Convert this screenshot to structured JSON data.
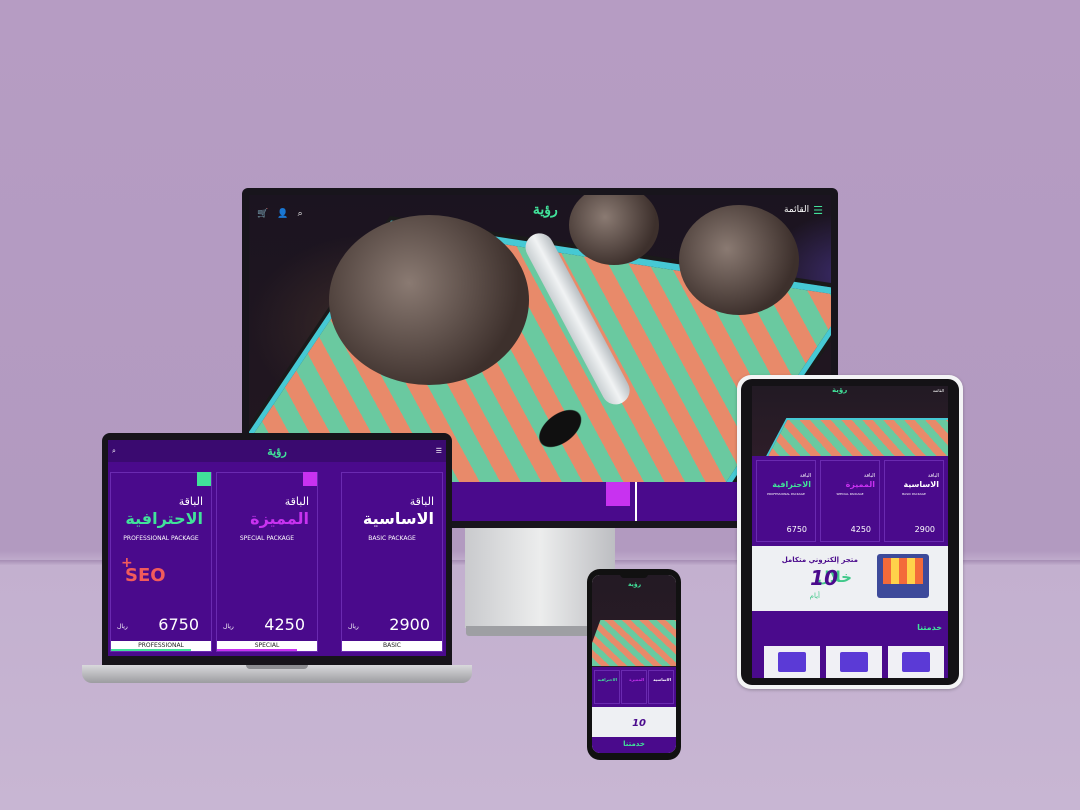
{
  "brand": {
    "logo": "رؤية",
    "accent": "#41e29a",
    "purple": "#4a0a8c",
    "magenta": "#c832f0"
  },
  "nav": {
    "menu_label": "القائمة",
    "icons": [
      "cart-icon",
      "user-icon",
      "search-icon",
      "menu-icon"
    ]
  },
  "packages": [
    {
      "prefix": "الباقة",
      "name": "الاحترافية",
      "name_en": "PROFESSIONAL PACKAGE",
      "price": "6750",
      "currency": "ريال",
      "footer": "PROFESSIONAL",
      "color": "#41e29a",
      "badge": "SEO"
    },
    {
      "prefix": "الباقة",
      "name": "المميزة",
      "name_en": "SPECIAL PACKAGE",
      "price": "4250",
      "currency": "ريال",
      "footer": "SPECIAL",
      "color": "#c832f0"
    },
    {
      "prefix": "الباقة",
      "name": "الاساسية",
      "name_en": "BASIC PACKAGE",
      "price": "2900",
      "currency": "ريال",
      "footer": "BASIC",
      "color": "#ffffff"
    }
  ],
  "promo": {
    "title": "متجر إلكتروني متكامل",
    "number": "10",
    "within": "خلال",
    "days": "أيام"
  },
  "services": {
    "title": "خدمتنا"
  }
}
